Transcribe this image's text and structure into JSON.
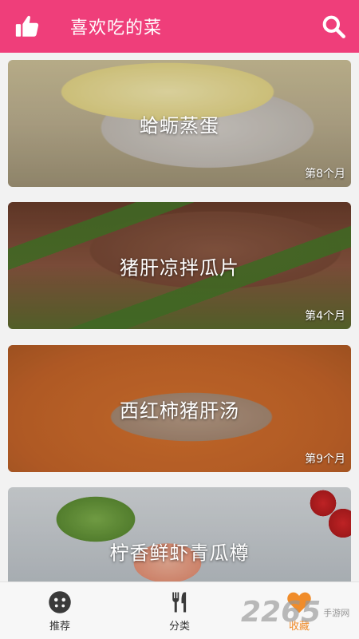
{
  "header": {
    "title": "喜欢吃的菜",
    "like_icon": "thumbs-up-icon",
    "search_icon": "search-icon",
    "bg_color": "#ef3e7a"
  },
  "dishes": [
    {
      "name": "蛤蛎蒸蛋",
      "age": "第8个月"
    },
    {
      "name": "猪肝凉拌瓜片",
      "age": "第4个月"
    },
    {
      "name": "西红柿猪肝汤",
      "age": "第9个月"
    },
    {
      "name": "柠香鲜虾青瓜樽",
      "age": ""
    }
  ],
  "tabs": [
    {
      "label": "推荐",
      "icon": "face-icon",
      "active": false
    },
    {
      "label": "分类",
      "icon": "utensils-icon",
      "active": false
    },
    {
      "label": "收藏",
      "icon": "heart-icon",
      "active": true
    }
  ],
  "colors": {
    "accent": "#ef3e7a",
    "tab_active": "#f08c2a"
  },
  "watermark": {
    "number": "2265",
    "text": "手游网"
  }
}
